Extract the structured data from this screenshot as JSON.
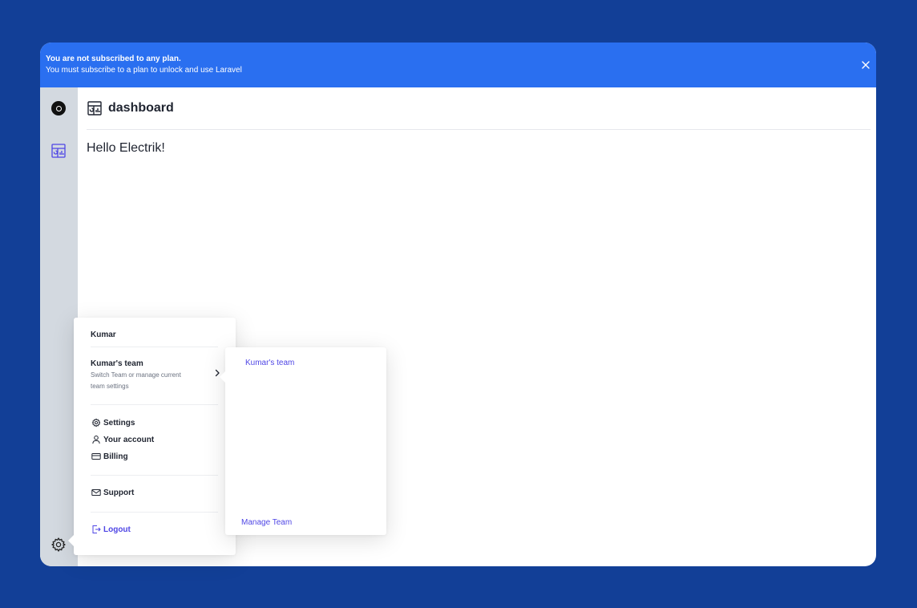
{
  "banner": {
    "title": "You are not subscribed to any plan.",
    "message": "You must subscribe to a plan to unlock and use Laravel",
    "close_icon": "close-icon",
    "background": "#2a6ff0"
  },
  "sidebar": {
    "logo_icon": "logo-icon",
    "nav_icon": "dashboard-icon",
    "settings_icon": "gear-icon",
    "background": "#d3d9e0"
  },
  "header": {
    "icon": "dashboard-icon",
    "title": "dashboard"
  },
  "main": {
    "greeting": "Hello Electrik!"
  },
  "user_menu": {
    "user_name": "Kumar",
    "team": {
      "name": "Kumar's team",
      "description": "Switch Team or manage current team settings"
    },
    "items": [
      {
        "label": "Settings",
        "icon": "gear-icon"
      },
      {
        "label": "Your account",
        "icon": "user-icon"
      },
      {
        "label": "Billing",
        "icon": "credit-card-icon"
      }
    ],
    "support": {
      "label": "Support",
      "icon": "mail-icon"
    },
    "logout": {
      "label": "Logout",
      "icon": "logout-icon"
    }
  },
  "team_submenu": {
    "current_team": "Kumar's team",
    "manage_label": "Manage Team"
  },
  "colors": {
    "page_background": "#123f97",
    "accent": "#4f46e5"
  }
}
